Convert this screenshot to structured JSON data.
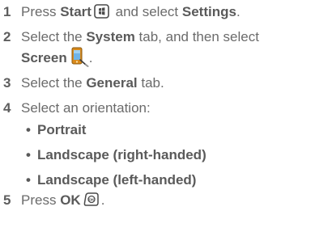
{
  "steps": [
    {
      "number": "1",
      "parts": [
        "Press ",
        "Start",
        " and select ",
        "Settings",
        "."
      ],
      "icon": "start-button-icon"
    },
    {
      "number": "2",
      "parts": [
        "Select the ",
        "System",
        " tab, and then select",
        "Screen",
        "."
      ],
      "icon": "screen-icon"
    },
    {
      "number": "3",
      "parts": [
        "Select the ",
        "General",
        " tab."
      ]
    },
    {
      "number": "4",
      "parts": [
        "Select an orientation:"
      ],
      "options": [
        "Portrait",
        "Landscape (right-handed)",
        "Landscape (left-handed)"
      ],
      "bullet": "•"
    },
    {
      "number": "5",
      "parts": [
        "Press ",
        "OK",
        "."
      ],
      "icon": "ok-button-icon"
    }
  ]
}
